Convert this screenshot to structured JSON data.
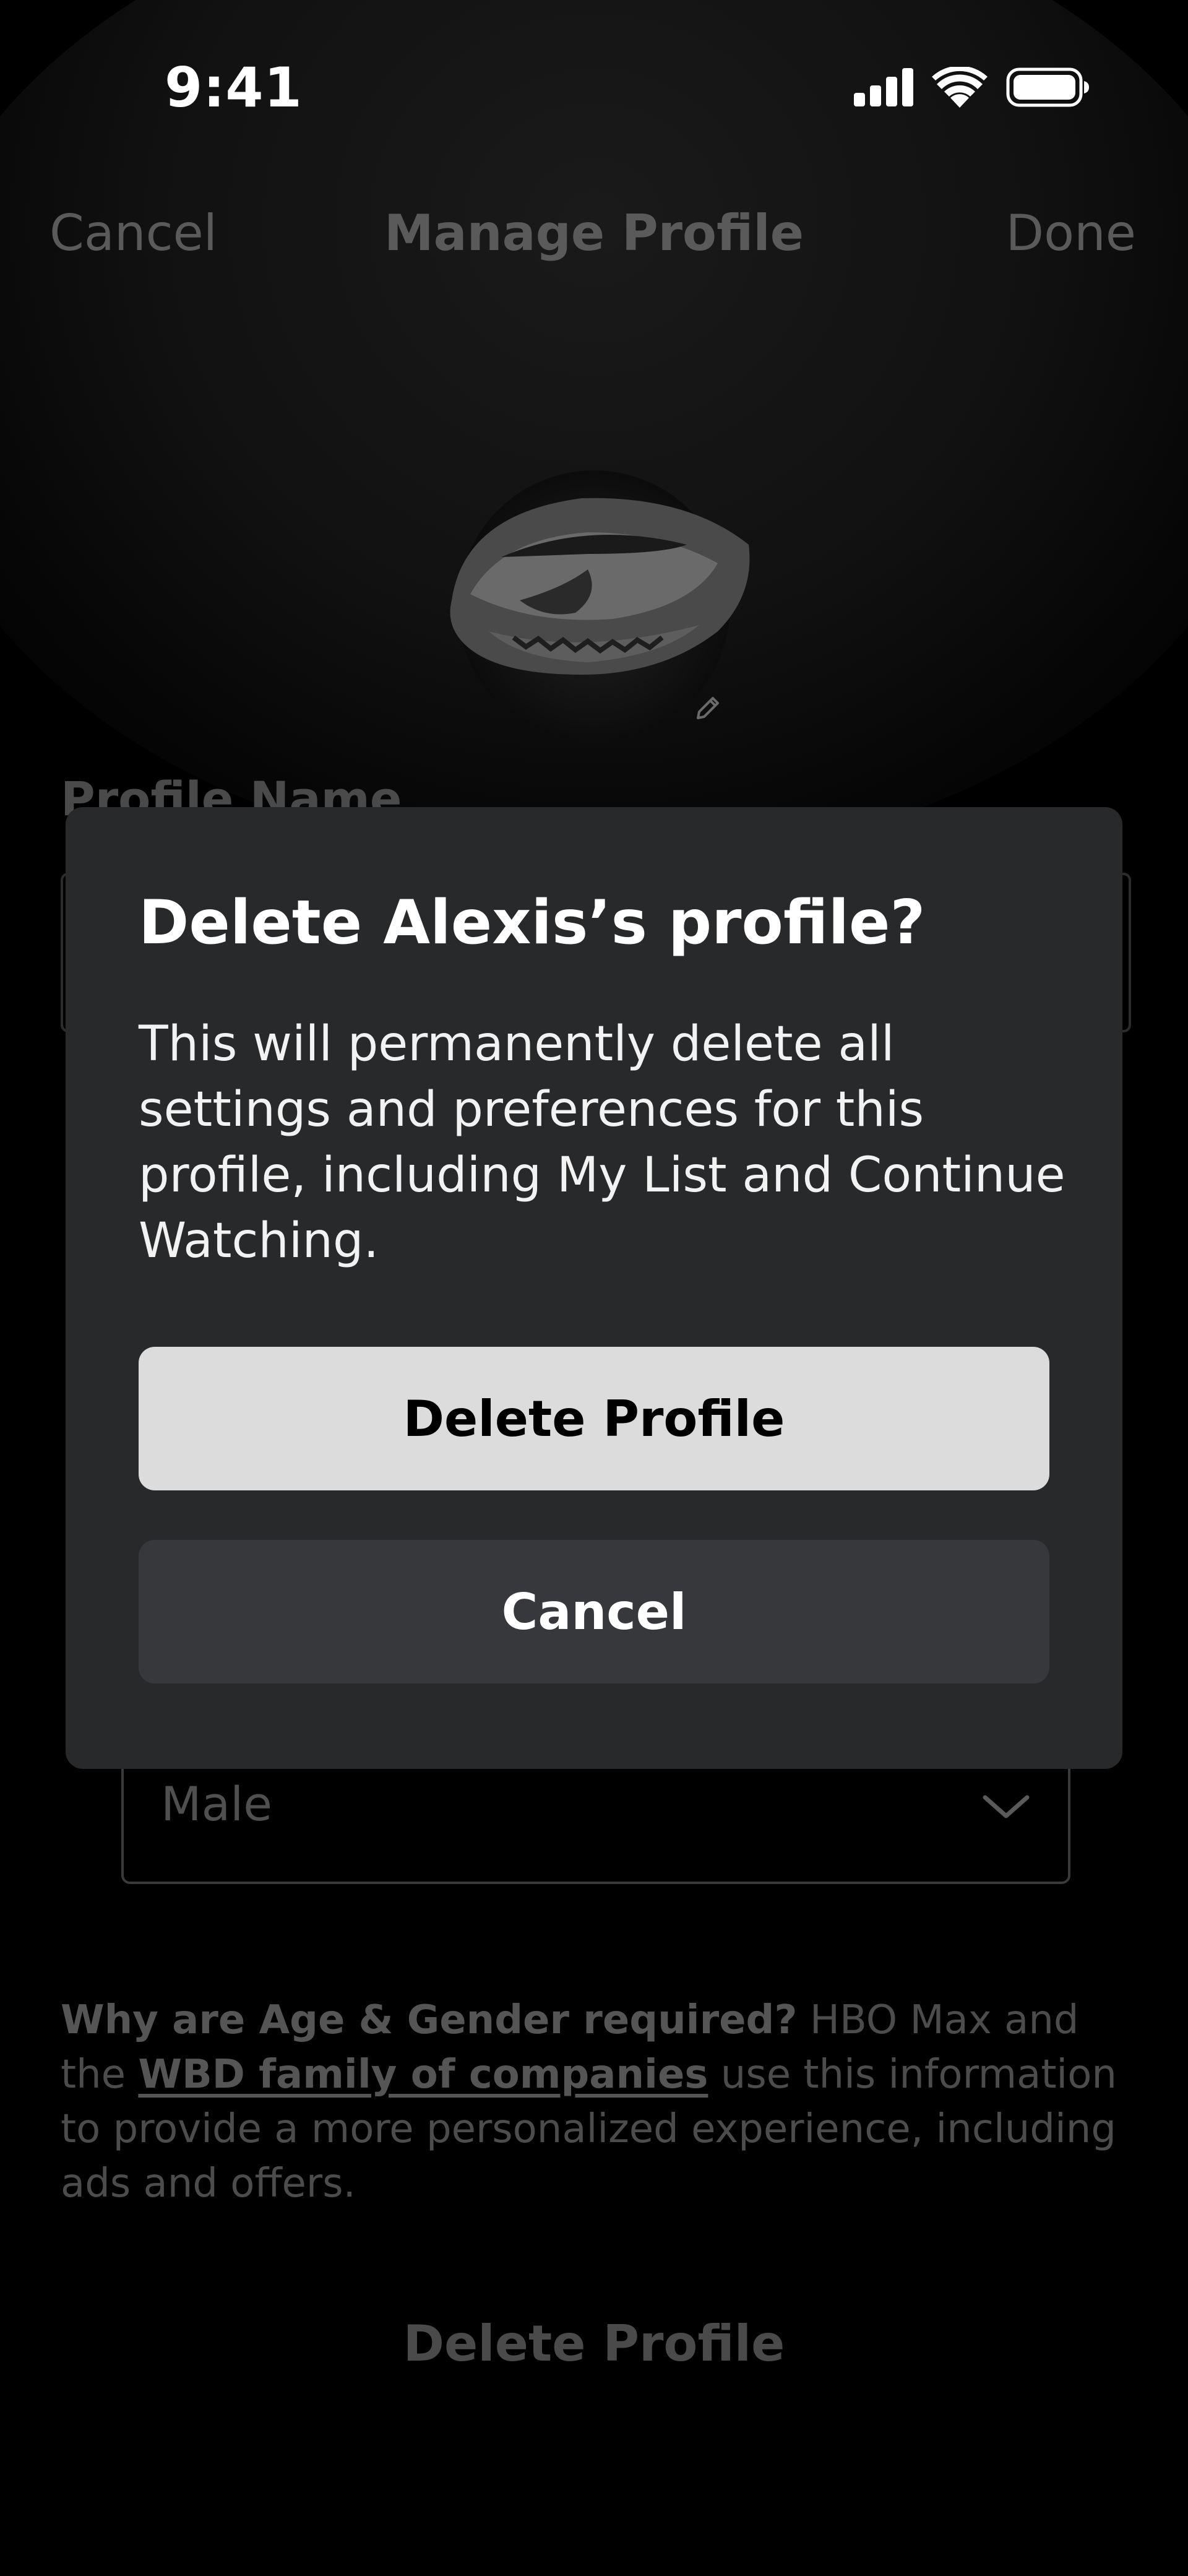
{
  "status_bar": {
    "time": "9:41"
  },
  "nav": {
    "cancel_label": "Cancel",
    "title": "Manage Profile",
    "done_label": "Done"
  },
  "form": {
    "profile_name_label": "Profile Name",
    "gender_value": "Male"
  },
  "disclaimer": {
    "question": "Why are Age & Gender required?",
    "text_before_link": " HBO Max and the ",
    "link_text": "WBD family of companies",
    "text_after_link": " use this information to provide a more personalized experience, including ads and offers."
  },
  "bottom": {
    "delete_label": "Delete Profile"
  },
  "dialog": {
    "title": "Delete Alexis’s profile?",
    "body": "This will permanently delete all settings and preferences for this profile, including My List and Continue Watching.",
    "primary_label": "Delete Profile",
    "secondary_label": "Cancel"
  },
  "icons": {
    "signal": "cellular-signal-icon",
    "wifi": "wifi-icon",
    "battery": "battery-icon",
    "edit": "pencil-icon",
    "chevron": "chevron-down-icon"
  },
  "colors": {
    "dialog_bg": "#28292a",
    "primary_button_bg": "#dcdcdc",
    "secondary_button_bg": "#37383b",
    "dimmed_text": "#5a5a5a"
  }
}
